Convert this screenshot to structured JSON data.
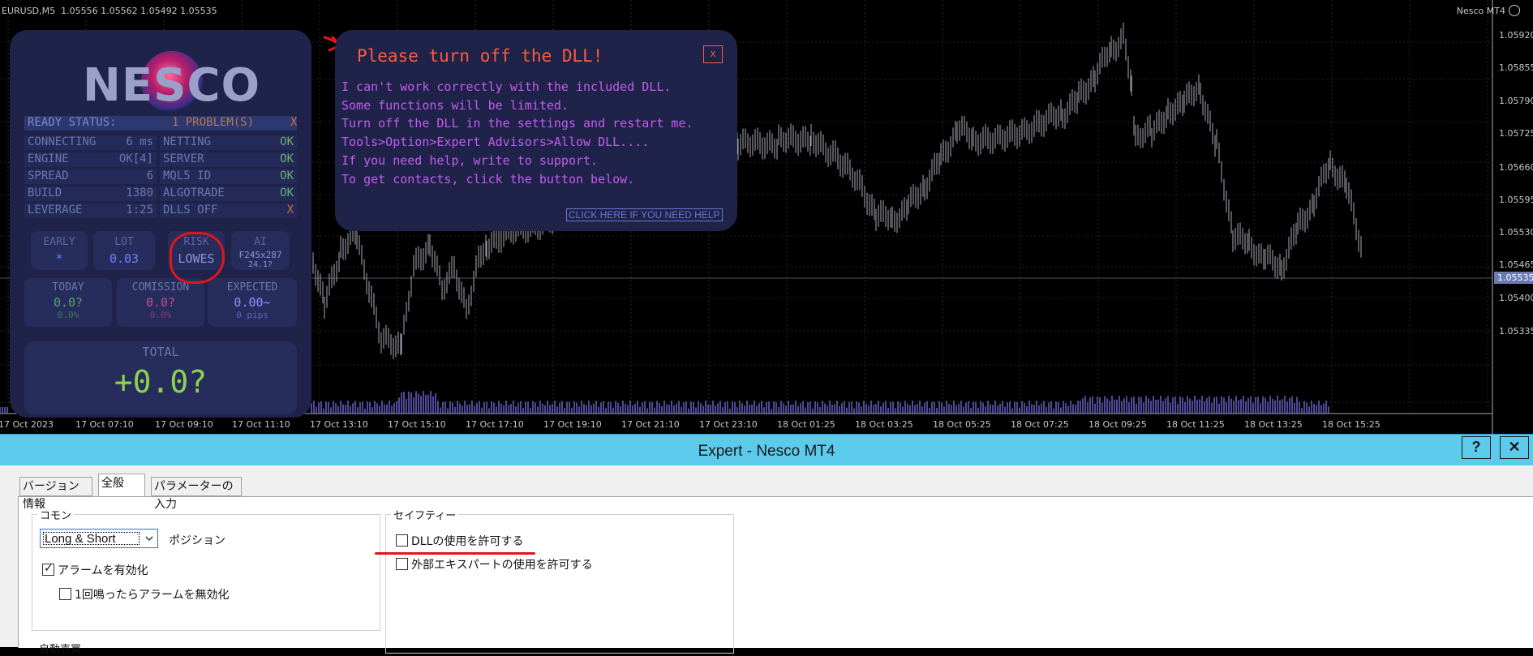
{
  "chart": {
    "symbol_header": "EURUSD,M5  1.05556 1.05562 1.05492 1.05535",
    "brand": "Nesco MT4",
    "price_ticks": [
      "1.05920",
      "1.05855",
      "1.05790",
      "1.05725",
      "1.05660",
      "1.05595",
      "1.05530",
      "1.05465",
      "1.05400",
      "1.05335"
    ],
    "current_price": "1.05535",
    "time_ticks": [
      "17 Oct 2023",
      "17 Oct 07:10",
      "17 Oct 09:10",
      "17 Oct 11:10",
      "17 Oct 13:10",
      "17 Oct 15:10",
      "17 Oct 17:10",
      "17 Oct 19:10",
      "17 Oct 21:10",
      "17 Oct 23:10",
      "18 Oct 01:25",
      "18 Oct 03:25",
      "18 Oct 05:25",
      "18 Oct 07:25",
      "18 Oct 09:25",
      "18 Oct 11:25",
      "18 Oct 13:25",
      "18 Oct 15:25"
    ],
    "colors": {
      "candle": "#a9a9b6",
      "volume": "#6a61c9",
      "bg": "#000000"
    }
  },
  "nesco": {
    "logo": "NESCO",
    "ready": {
      "label": "READY STATUS:",
      "value": "1 PROBLEM(S)",
      "mark": "X"
    },
    "stats": [
      {
        "k": "CONNECTING",
        "v": "6 ms",
        "k2": "NETTING",
        "v2": "OK",
        "s2": "ok"
      },
      {
        "k": "ENGINE",
        "v": "OK[4]",
        "k2": "SERVER",
        "v2": "OK",
        "s2": "ok"
      },
      {
        "k": "SPREAD",
        "v": "6",
        "k2": "MQL5 ID",
        "v2": "OK",
        "s2": "ok"
      },
      {
        "k": "BUILD",
        "v": "1380",
        "k2": "ALGOTRADE",
        "v2": "OK",
        "s2": "ok"
      },
      {
        "k": "LEVERAGE",
        "v": "1:25",
        "k2": "DLLS OFF",
        "v2": "X",
        "s2": "x"
      }
    ],
    "boxes": [
      {
        "t": "EARLY",
        "v": "*",
        "s": ""
      },
      {
        "t": "LOT",
        "v": "0.03",
        "s": ""
      },
      {
        "t": "RISK",
        "v": "LOWES",
        "s": ""
      },
      {
        "t": "AI",
        "v": "F245x287",
        "s": "24.1?"
      }
    ],
    "metrics": [
      {
        "t": "TODAY",
        "v": "0.0?",
        "s": "0.0%"
      },
      {
        "t": "COMISSION",
        "v": "0.0?",
        "s": "0.0%"
      },
      {
        "t": "EXPECTED",
        "v": "0.00~",
        "s": "0 pips"
      }
    ],
    "total": {
      "t": "TOTAL",
      "v": "+0.0?"
    }
  },
  "popup": {
    "title": "Please turn off the DLL!",
    "close": "x",
    "lines": [
      "I can't work correctly with the included DLL.",
      "Some functions will be limited.",
      "Turn off the DLL in the settings and restart me.",
      "Tools>Option>Expert Advisors>Allow DLL....",
      "If you need help, write to support.",
      "To get contacts, click the button below."
    ],
    "help_button": "CLICK HERE IF YOU NEED HELP"
  },
  "dialog": {
    "title": "Expert - Nesco MT4",
    "help_btn": "?",
    "close_btn": "✕",
    "tabs": [
      "バージョン情報",
      "全般",
      "パラメーターの入力"
    ],
    "common_group": "コモン",
    "position_select": "Long & Short",
    "position_label": "ポジション",
    "alarm_enable": "アラームを有効化",
    "alarm_once": "1回鳴ったらアラームを無効化",
    "safety_group": "セイフティー",
    "allow_dll": "DLLの使用を許可する",
    "allow_external": "外部エキスパートの使用を許可する",
    "cut_label": "自動売買"
  }
}
